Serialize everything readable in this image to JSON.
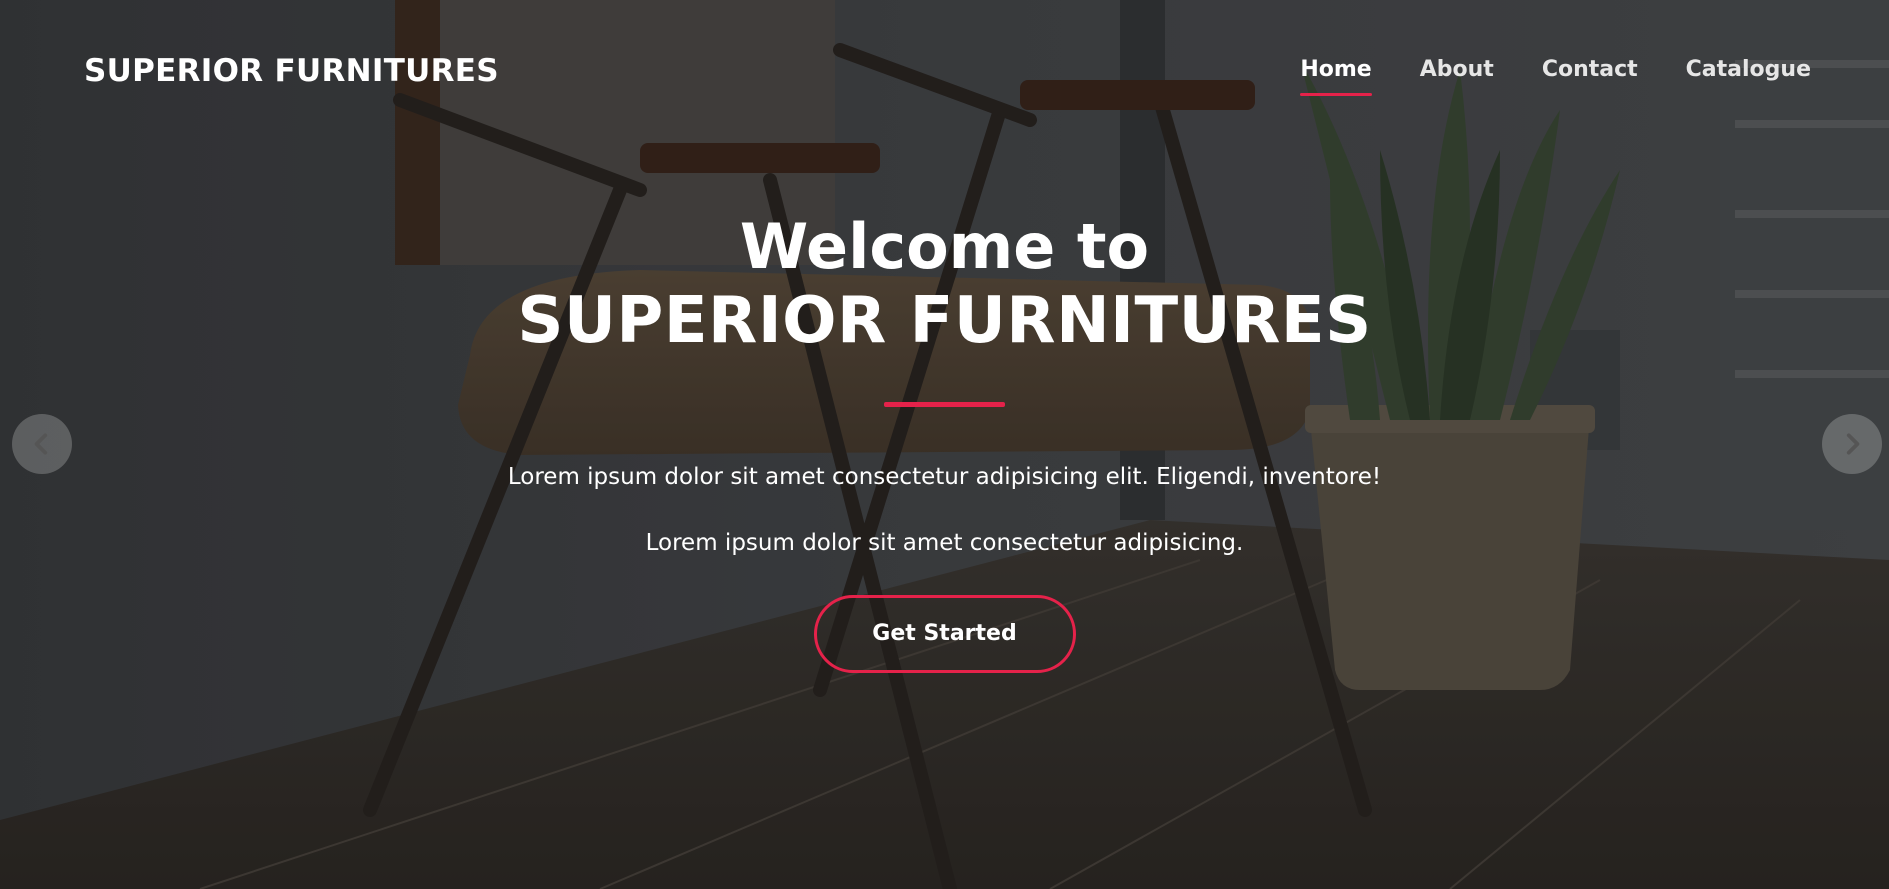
{
  "brand": "SUPERIOR FURNITURES",
  "nav": {
    "items": [
      {
        "label": "Home",
        "active": true
      },
      {
        "label": "About",
        "active": false
      },
      {
        "label": "Contact",
        "active": false
      },
      {
        "label": "Catalogue",
        "active": false
      }
    ]
  },
  "hero": {
    "title_line1": "Welcome to",
    "title_line2": "SUPERIOR FURNITURES",
    "paragraph1": "Lorem ipsum dolor sit amet consectetur adipisicing elit. Eligendi, inventore!",
    "paragraph2": "Lorem ipsum dolor sit amet consectetur adipisicing.",
    "cta_label": "Get Started"
  },
  "carousel": {
    "prev_icon": "chevron-left-icon",
    "next_icon": "chevron-right-icon"
  },
  "colors": {
    "accent": "#e5224a",
    "text": "#ffffff"
  }
}
